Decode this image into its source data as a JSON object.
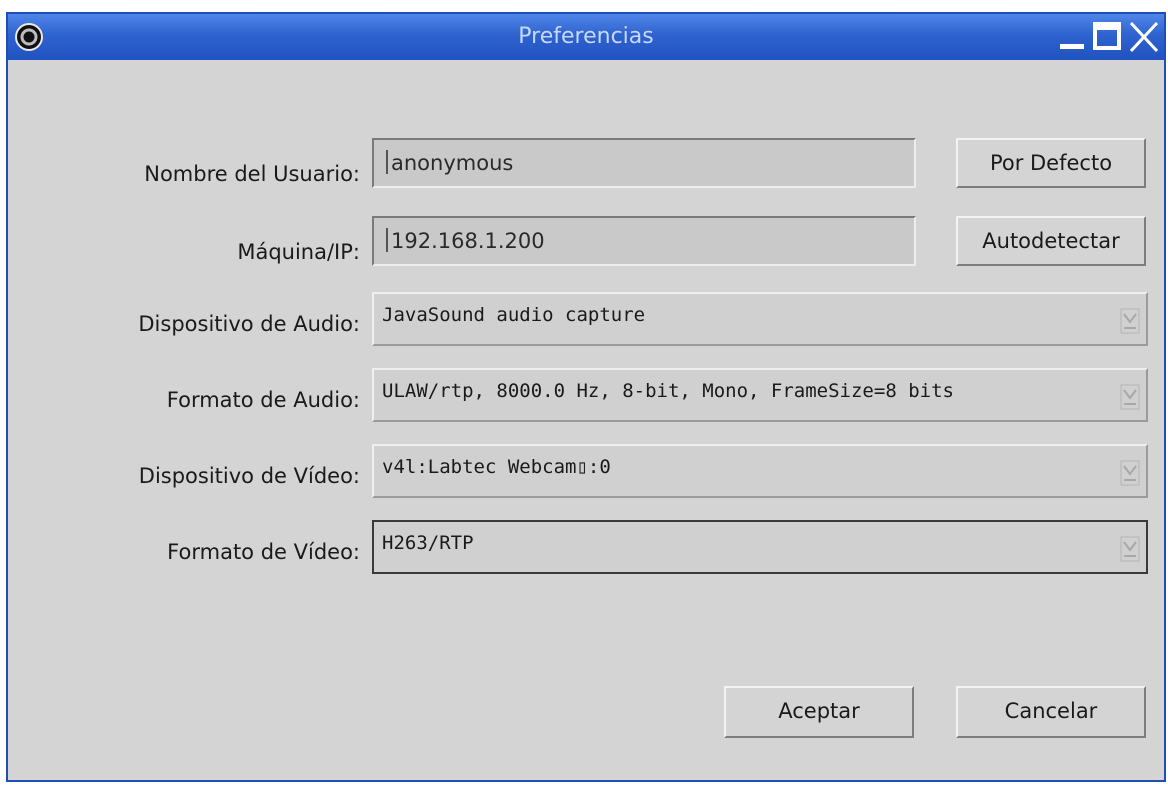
{
  "window": {
    "title": "Preferencias"
  },
  "fields": {
    "username": {
      "label": "Nombre del Usuario:",
      "value": "anonymous",
      "button": "Por Defecto"
    },
    "host": {
      "label": "Máquina/IP:",
      "value": "192.168.1.200",
      "button": "Autodetectar"
    },
    "audio_device": {
      "label": "Dispositivo de Audio:",
      "value": "JavaSound audio capture"
    },
    "audio_format": {
      "label": "Formato de Audio:",
      "value": "ULAW/rtp, 8000.0 Hz, 8-bit, Mono, FrameSize=8 bits"
    },
    "video_device": {
      "label": "Dispositivo de Vídeo:",
      "value": "v4l:Labtec Webcam▯:0"
    },
    "video_format": {
      "label": "Formato de Vídeo:",
      "value": "H263/RTP"
    }
  },
  "actions": {
    "accept": "Aceptar",
    "cancel": "Cancelar"
  },
  "colors": {
    "titlebar": "#2f63cf",
    "window_bg": "#d4d4d4",
    "input_bg": "#c9c9c9"
  },
  "icons": {
    "app": "app-menu-icon",
    "minimize": "minimize-icon",
    "maximize": "maximize-icon",
    "close": "close-icon",
    "dropdown": "dropdown-arrow-icon"
  }
}
